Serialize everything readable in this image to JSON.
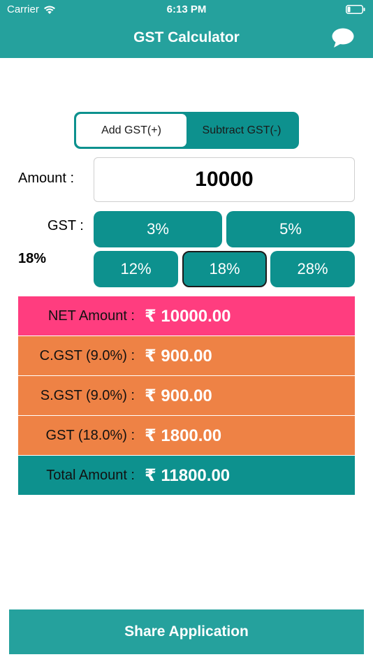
{
  "status_bar": {
    "carrier": "Carrier",
    "time": "6:13 PM"
  },
  "nav": {
    "title": "GST Calculator"
  },
  "mode_toggle": {
    "add_label": "Add GST(+)",
    "subtract_label": "Subtract GST(-)",
    "selected": "add"
  },
  "amount": {
    "label": "Amount :",
    "value": "10000"
  },
  "gst": {
    "label": "GST :",
    "selected_display": "18%",
    "rates": [
      "3%",
      "5%",
      "12%",
      "18%",
      "28%"
    ],
    "selected": "18%"
  },
  "results": {
    "net": {
      "label": "NET Amount :",
      "value": "₹ 10000.00"
    },
    "cgst": {
      "label": "C.GST (9.0%) :",
      "value": "₹ 900.00"
    },
    "sgst": {
      "label": "S.GST (9.0%) :",
      "value": "₹ 900.00"
    },
    "gst": {
      "label": "GST (18.0%) :",
      "value": "₹ 1800.00"
    },
    "total": {
      "label": "Total Amount :",
      "value": "₹ 11800.00"
    }
  },
  "share": {
    "label": "Share Application"
  },
  "colors": {
    "primary": "#25A19D",
    "button_teal": "#0D918E",
    "net_pink": "#FF3D7F",
    "tax_orange": "#EE8245"
  },
  "icons": {
    "wifi": "wifi-icon",
    "battery": "battery-icon",
    "chat": "chat-bubble-icon"
  }
}
